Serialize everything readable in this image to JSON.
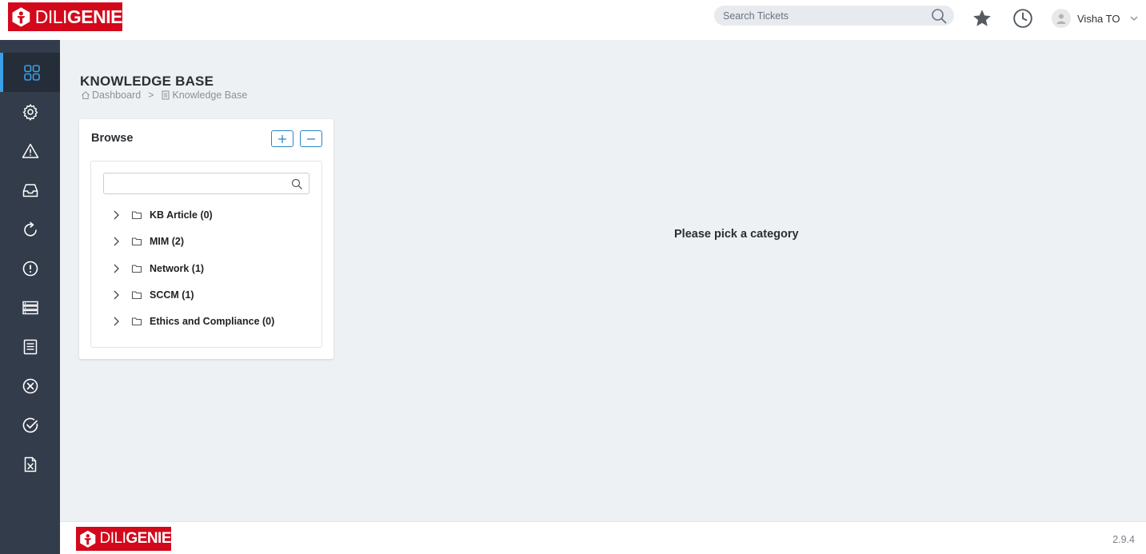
{
  "brand": {
    "name_part1": "DILI",
    "name_part2": "GENIE",
    "primary_color": "#d3081b"
  },
  "header": {
    "search_placeholder": "Search Tickets",
    "search_icon": "search-icon",
    "favorites_icon": "star-icon",
    "history_icon": "clock-icon",
    "user": {
      "name": "Visha TO",
      "caret_icon": "chevron-down-icon"
    }
  },
  "sidebar": {
    "accent_color": "#3aa0e8",
    "items": [
      {
        "icon": "dashboard-grid-icon",
        "active": true
      },
      {
        "icon": "gear-icon",
        "active": false
      },
      {
        "icon": "warning-triangle-icon",
        "active": false
      },
      {
        "icon": "inbox-icon",
        "active": false
      },
      {
        "icon": "refresh-icon",
        "active": false
      },
      {
        "icon": "alert-circle-icon",
        "active": false
      },
      {
        "icon": "server-list-icon",
        "active": false
      },
      {
        "icon": "document-icon",
        "active": false
      },
      {
        "icon": "close-circle-icon",
        "active": false
      },
      {
        "icon": "check-circle-icon",
        "active": false
      },
      {
        "icon": "excel-file-icon",
        "active": false
      }
    ]
  },
  "page": {
    "title": "KNOWLEDGE BASE",
    "breadcrumb": [
      {
        "label": "Dashboard",
        "icon": "home-icon"
      },
      {
        "label": "Knowledge Base",
        "icon": "document-icon"
      }
    ],
    "breadcrumb_separator": ">"
  },
  "browse": {
    "title": "Browse",
    "expand_all_icon": "plus-icon",
    "collapse_all_icon": "minus-icon",
    "search_value": "",
    "categories": [
      {
        "label": "KB Article (0)"
      },
      {
        "label": "MIM (2)"
      },
      {
        "label": "Network (1)"
      },
      {
        "label": "SCCM (1)"
      },
      {
        "label": "Ethics and Compliance (0)"
      }
    ]
  },
  "content": {
    "empty_message": "Please pick a category"
  },
  "footer": {
    "version": "2.9.4"
  }
}
